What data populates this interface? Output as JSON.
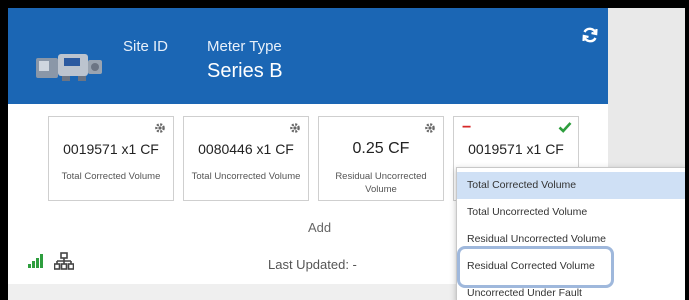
{
  "header": {
    "site_id_label": "Site ID",
    "meter_type_label": "Meter Type",
    "meter_type_value": "Series B",
    "refresh_icon": "refresh-icon",
    "background_color": "#1b66b4"
  },
  "tiles": [
    {
      "value": "0019571 x1 CF",
      "label": "Total Corrected Volume",
      "icon": "gear-icon"
    },
    {
      "value": "0080446 x1 CF",
      "label": "Total Uncorrected Volume",
      "icon": "gear-icon"
    },
    {
      "value": "0.25 CF",
      "label": "Residual Uncorrected Volume",
      "icon": "gear-icon"
    },
    {
      "value": "0019571 x1 CF",
      "minus": "−",
      "icon": "check-icon",
      "check_color": "#2e9e3e",
      "minus_color": "#d62828"
    }
  ],
  "add_label": "Add",
  "status": {
    "signal_icon": "signal-bars-icon",
    "network_icon": "network-icon",
    "last_updated": "Last Updated: -"
  },
  "dropdown": {
    "items": [
      "Total Corrected Volume",
      "Total Uncorrected Volume",
      "Residual Uncorrected Volume",
      "Residual Corrected Volume",
      "Uncorrected Under Fault"
    ],
    "selected": "Total Corrected Volume",
    "highlighted": "Residual Corrected Volume"
  }
}
